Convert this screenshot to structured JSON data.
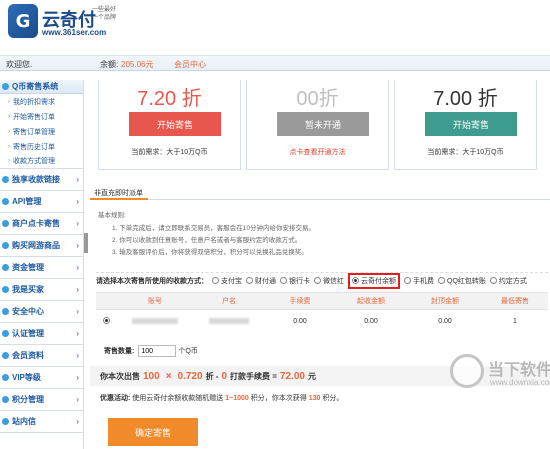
{
  "header": {
    "logo_glyph": "G",
    "title": "云奇付",
    "slogan": "一些最好 一个品牌",
    "url": "www.361ser.com"
  },
  "userbar": {
    "welcome": "欢迎您.",
    "balance_label": "余额:",
    "balance_value": "205.06元",
    "member_center": "会员中心"
  },
  "sidebar": {
    "open_section": "Q币寄售系统",
    "sub_items": [
      "我的折扣需求",
      "开始寄售订单",
      "寄售订单管理",
      "寄售历史订单",
      "收款方式管理"
    ],
    "sections": [
      "独享收款链接",
      "API管理",
      "商户点卡寄售",
      "购买网游商品",
      "资金管理",
      "我是买家",
      "安全中心",
      "认证管理",
      "会员资料",
      "VIP等级",
      "积分管理",
      "站内信"
    ]
  },
  "cards": [
    {
      "discount": "7.20 折",
      "button": "开始寄售",
      "requirement": "当前需求：大于10万Q币",
      "color": "#e8574d",
      "btn_color": "#e8574d",
      "req_color": "#333333"
    },
    {
      "discount": "00折",
      "button": "暂未开通",
      "requirement": "点卡查看开通方法",
      "color": "#bfbfbf",
      "btn_color": "#9a9a9a",
      "req_color": "#e03b2a"
    },
    {
      "discount": "7.00 折",
      "button": "开始寄售",
      "requirement": "当前需求：大于10万Q币",
      "color": "#333333",
      "btn_color": "#3e9c8f",
      "req_color": "#333333"
    }
  ],
  "tab": {
    "label": "非直充即时派单"
  },
  "rules": {
    "title": "基本规则:",
    "lines": [
      "1. 下单完成后，请立即联系交易员，客服会在10分钟内给你安排交易。",
      "2. 你可以收款到任意账号，任意户名或者与客服约定的收款方式。",
      "3. 输及客服评价后，你将获得双倍积分，积分可以兑换礼品兑换奖。"
    ]
  },
  "pay_methods": {
    "label": "请选择本次寄售所使用的收款方式：",
    "options": [
      "支付宝",
      "财付通",
      "银行卡",
      "微信红",
      "云奇付余额",
      "手机费",
      "QQ红包转账",
      "约定方式"
    ],
    "selected_index": 4
  },
  "table": {
    "headers": [
      "账号",
      "户名",
      "手续费",
      "起收金额",
      "封顶金额",
      "最低寄售"
    ],
    "row": {
      "fee": "0.00",
      "min_amount": "0.00",
      "max_amount": "0.00",
      "min_consign": "1"
    }
  },
  "quantity": {
    "label": "寄售数量:",
    "value": "100",
    "unit": "个Q币"
  },
  "summary": {
    "prefix": "你本次出售",
    "qty": "100",
    "times": "×",
    "rate": "0.720",
    "rate_suffix": "折 -",
    "fee": "0",
    "mid": "打款手续费 =",
    "total": "72.00",
    "unit": "元"
  },
  "promo": {
    "label": "优惠活动:",
    "text1": "使用云奇付余额收款随机赠送",
    "range": "1~1000",
    "text2": "积分，你本次获得",
    "points": "130",
    "text3": "积分。"
  },
  "submit": {
    "label": "确定寄售"
  },
  "watermark": {
    "text": "当下软件园",
    "url": "www.downxia.com"
  }
}
